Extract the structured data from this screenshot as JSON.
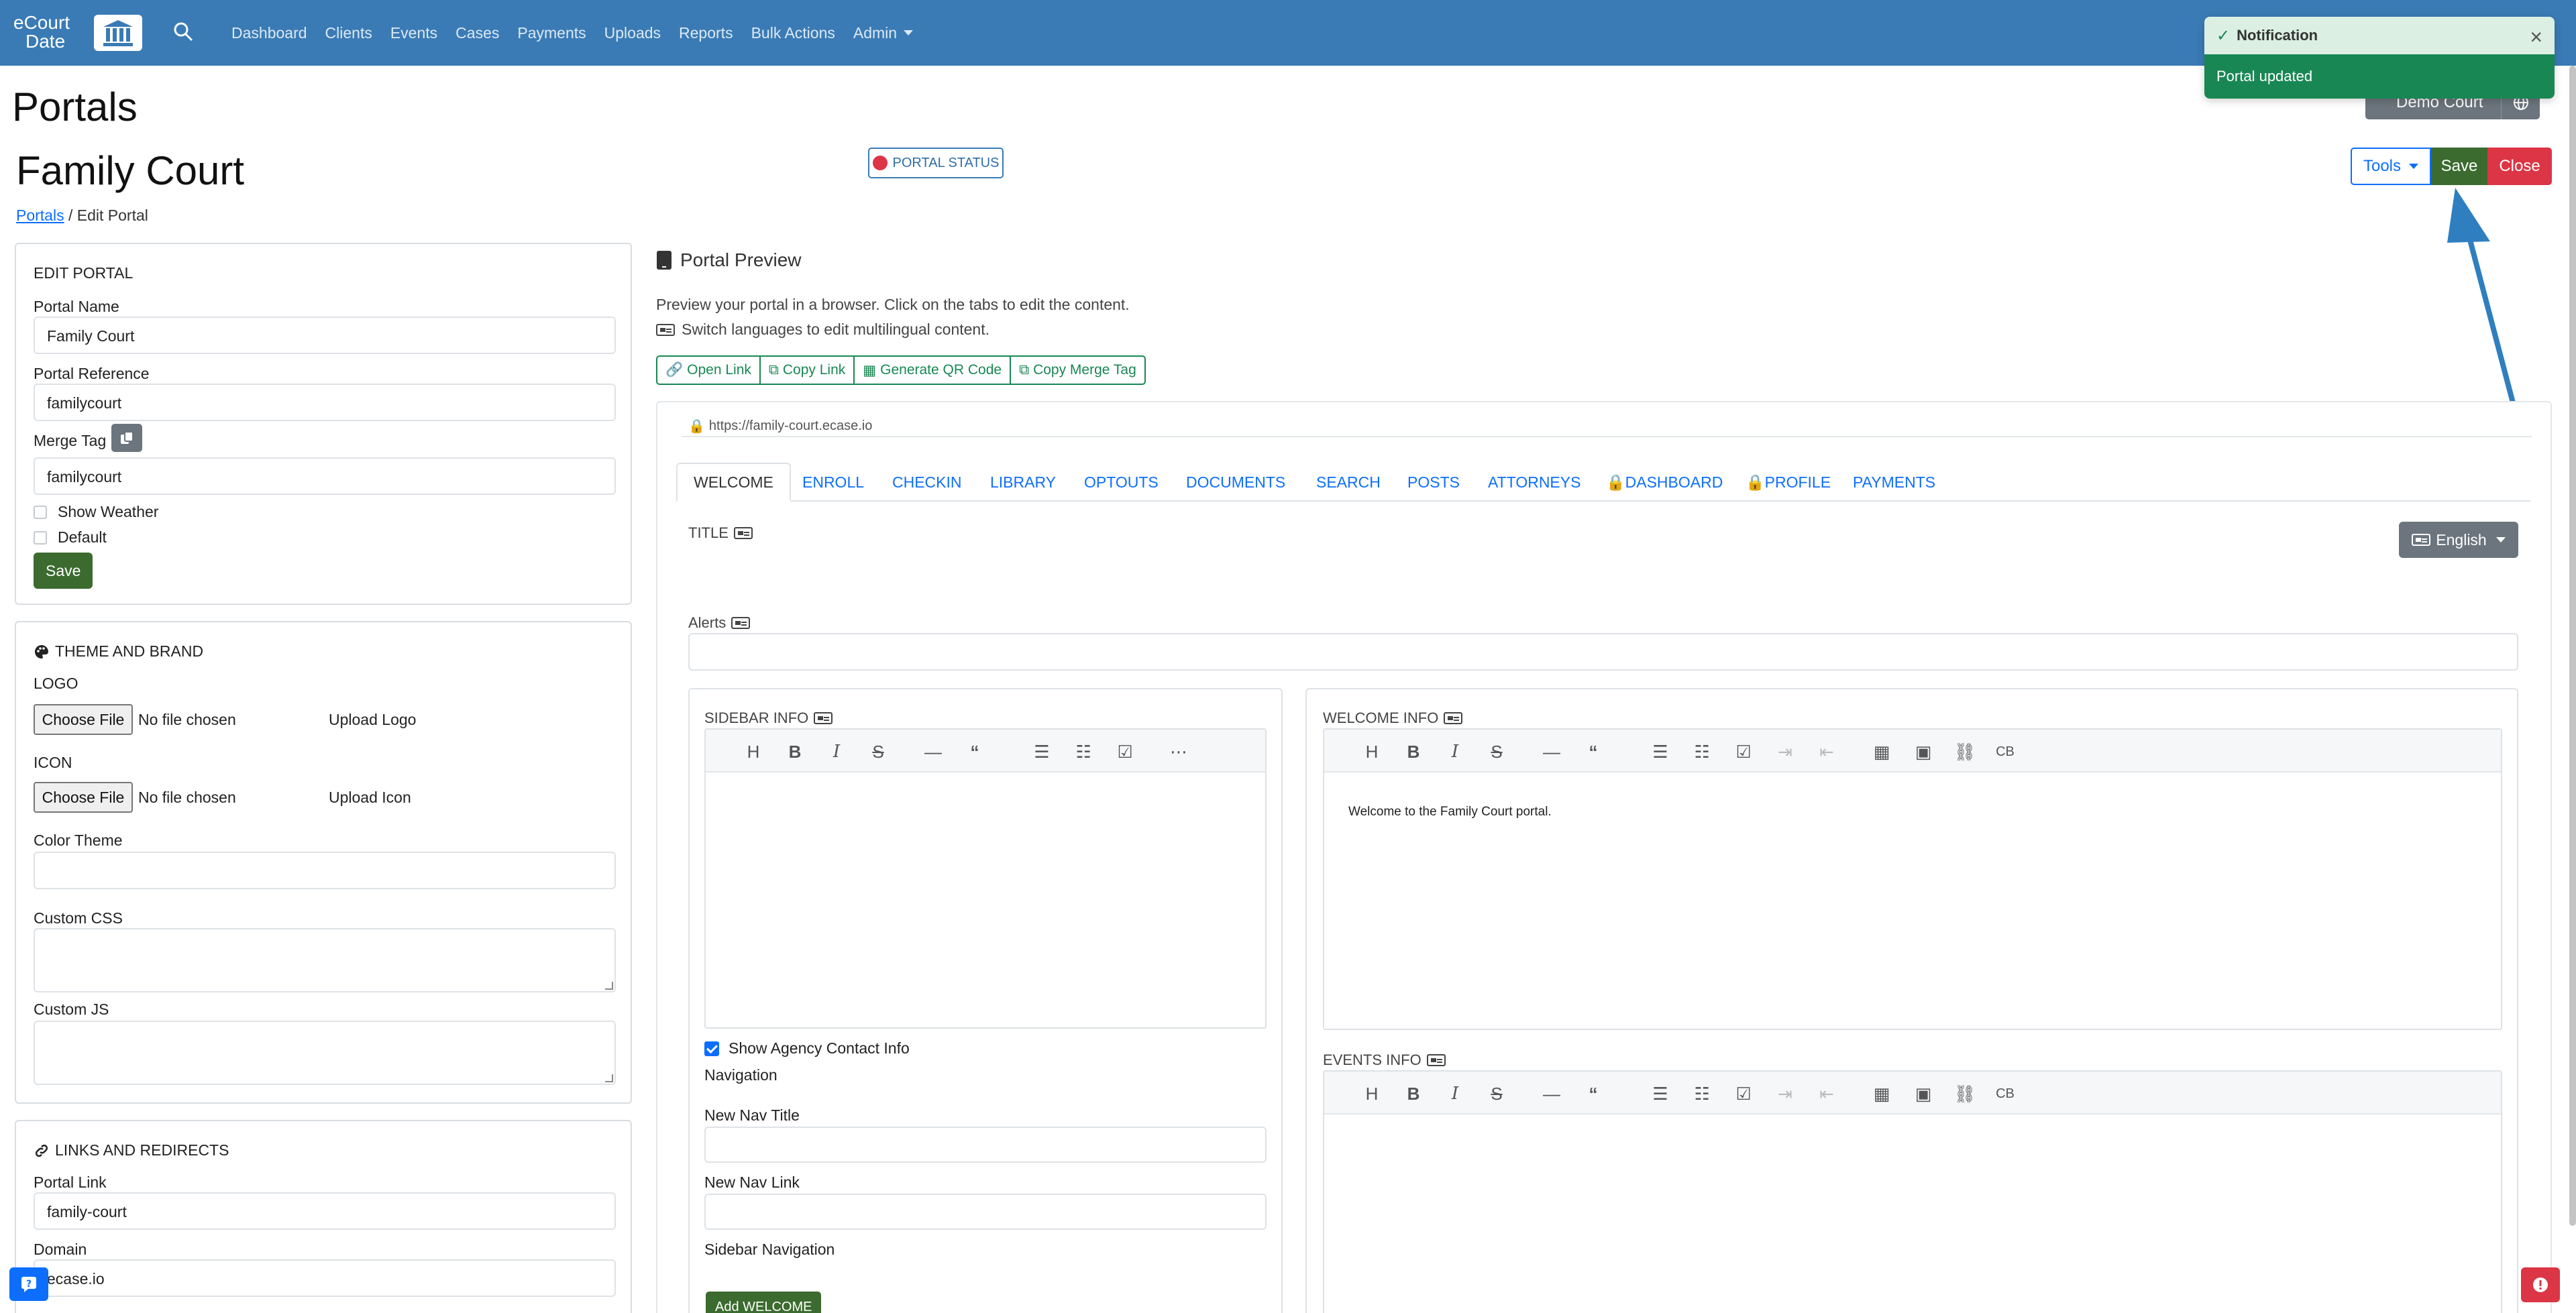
{
  "colors": {
    "navbar": "#3a7bb5",
    "primary": "#0d6efd",
    "success": "#3b6b2f",
    "danger": "#dc3545",
    "secondary": "#6c757d",
    "toast_body": "#198754",
    "annotation_arrow": "#2f7fc0"
  },
  "navbar": {
    "brand_line1": "eCourt",
    "brand_line2": "Date",
    "links": [
      "Dashboard",
      "Clients",
      "Events",
      "Cases",
      "Payments",
      "Uploads",
      "Reports",
      "Bulk Actions",
      "Admin"
    ]
  },
  "page": {
    "title": "Portals",
    "portal_name": "Family Court",
    "breadcrumb_link": "Portals",
    "breadcrumb_current": "/ Edit Portal",
    "portal_status_label": "PORTAL STATUS",
    "demo_court_label": "Demo Court"
  },
  "actions": {
    "tools_label": "Tools",
    "save_label": "Save",
    "close_label": "Close"
  },
  "toast": {
    "title": "Notification",
    "message": "Portal updated"
  },
  "edit_portal": {
    "heading": "EDIT PORTAL",
    "portal_name_label": "Portal Name",
    "portal_name_value": "Family Court",
    "portal_reference_label": "Portal Reference",
    "portal_reference_value": "familycourt",
    "merge_tag_label": "Merge Tag",
    "merge_tag_value": "familycourt",
    "show_weather_label": "Show Weather",
    "default_label": "Default",
    "save_label": "Save"
  },
  "theme_brand": {
    "heading": "THEME AND BRAND",
    "logo_label": "LOGO",
    "choose_file_label": "Choose File",
    "no_file_label": "No file chosen",
    "upload_logo_label": "Upload Logo",
    "icon_label": "ICON",
    "upload_icon_label": "Upload Icon",
    "color_theme_label": "Color Theme",
    "custom_css_label": "Custom CSS",
    "custom_js_label": "Custom JS"
  },
  "links_redirects": {
    "heading": "LINKS AND REDIRECTS",
    "portal_link_label": "Portal Link",
    "portal_link_value": "family-court",
    "domain_label": "Domain",
    "domain_value": "ecase.io"
  },
  "preview": {
    "title": "Portal Preview",
    "desc_line1": "Preview your portal in a browser. Click on the tabs to edit the content.",
    "desc_line2": "Switch languages to edit multilingual content.",
    "buttons": [
      "Open Link",
      "Copy Link",
      "Generate QR Code",
      "Copy Merge Tag"
    ],
    "url": "https://family-court.ecase.io",
    "tabs": [
      "WELCOME",
      "ENROLL",
      "CHECKIN",
      "LIBRARY",
      "OPTOUTS",
      "DOCUMENTS",
      "SEARCH",
      "POSTS",
      "ATTORNEYS",
      "DASHBOARD",
      "PROFILE",
      "PAYMENTS"
    ],
    "title_label": "TITLE",
    "language_label": "English",
    "alerts_label": "Alerts",
    "sidebar_info_label": "SIDEBAR INFO",
    "welcome_info_label": "WELCOME INFO",
    "welcome_text": "Welcome to the Family Court portal.",
    "events_info_label": "EVENTS INFO",
    "show_agency_label": "Show Agency Contact Info",
    "navigation_label": "Navigation",
    "new_nav_title_label": "New Nav Title",
    "new_nav_link_label": "New Nav Link",
    "sidebar_navigation_label": "Sidebar Navigation",
    "add_welcome_label": "Add WELCOME"
  }
}
